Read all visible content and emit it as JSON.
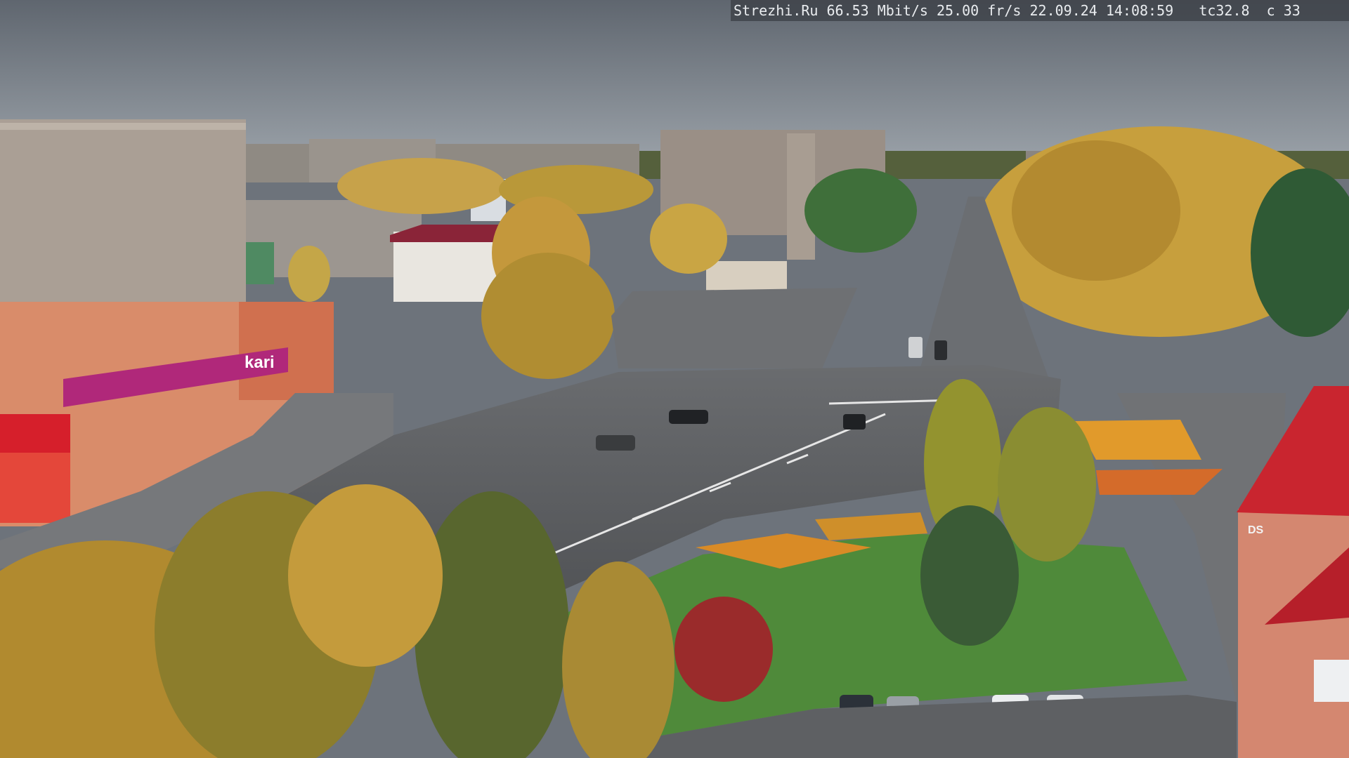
{
  "overlay": {
    "site": "Strezhi.Ru",
    "bitrate": "66.53 Mbit/s",
    "framerate": "25.00 fr/s",
    "datetime": "22.09.24 14:08:59",
    "tc": "tc32.8",
    "c": "c 33"
  },
  "signs": {
    "store_logo": "kari",
    "tower_sign": "DS"
  },
  "colors": {
    "sky": "#6f7680",
    "road": "#57595c",
    "grass": "#4f8a3a",
    "store_magenta": "#b0287a"
  }
}
